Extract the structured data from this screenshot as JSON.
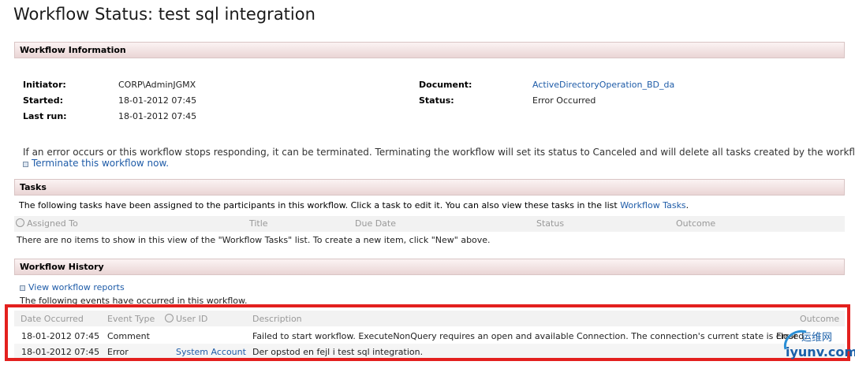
{
  "page": {
    "title": "Workflow Status: test sql integration"
  },
  "workflow_info": {
    "heading": "Workflow Information",
    "initiator_label": "Initiator:",
    "initiator_value": "CORP\\AdminJGMX",
    "started_label": "Started:",
    "started_value": "18-01-2012 07:45",
    "lastrun_label": "Last run:",
    "lastrun_value": "18-01-2012 07:45",
    "document_label": "Document:",
    "document_value": "ActiveDirectoryOperation_BD_da",
    "status_label": "Status:",
    "status_value": "Error Occurred",
    "terminate_note": "If an error occurs or this workflow stops responding, it can be terminated. Terminating the workflow will set its status to Canceled and will delete all tasks created by the workflow.",
    "terminate_link": "Terminate this workflow now."
  },
  "tasks": {
    "heading": "Tasks",
    "intro_text": "The following tasks have been assigned to the participants in this workflow. Click a task to edit it. You can also view these tasks in the list",
    "intro_link": "Workflow Tasks",
    "intro_end": ".",
    "columns": [
      "Assigned To",
      "Title",
      "Due Date",
      "Status",
      "Outcome"
    ],
    "empty_text": "There are no items to show in this view of the \"Workflow Tasks\" list. To create a new item, click \"New\" above."
  },
  "history": {
    "heading": "Workflow History",
    "reports_link": "View workflow reports",
    "events_text": "The following events have occurred in this workflow.",
    "columns": [
      "Date Occurred",
      "Event Type",
      "User ID",
      "Description",
      "Outcome"
    ],
    "rows": [
      {
        "date": "18-01-2012 07:45",
        "event": "Comment",
        "user": "",
        "description": "Failed to start workflow. ExecuteNonQuery requires an open and available Connection. The connection's current state is closed.",
        "outcome": "Error"
      },
      {
        "date": "18-01-2012 07:45",
        "event": "Error",
        "user": "System Account",
        "description": "Der opstod en fejl i test sql integration.",
        "outcome": ""
      }
    ]
  },
  "watermark": {
    "text_cn": "运维网",
    "text_url": "iyunv.com",
    "colors": {
      "ring": "#2a8fd6",
      "text": "#1a5fa8"
    }
  },
  "colors": {
    "highlight_border": "#e3201e",
    "link": "#1f5ca8",
    "section_bg": "#ead5d5"
  }
}
